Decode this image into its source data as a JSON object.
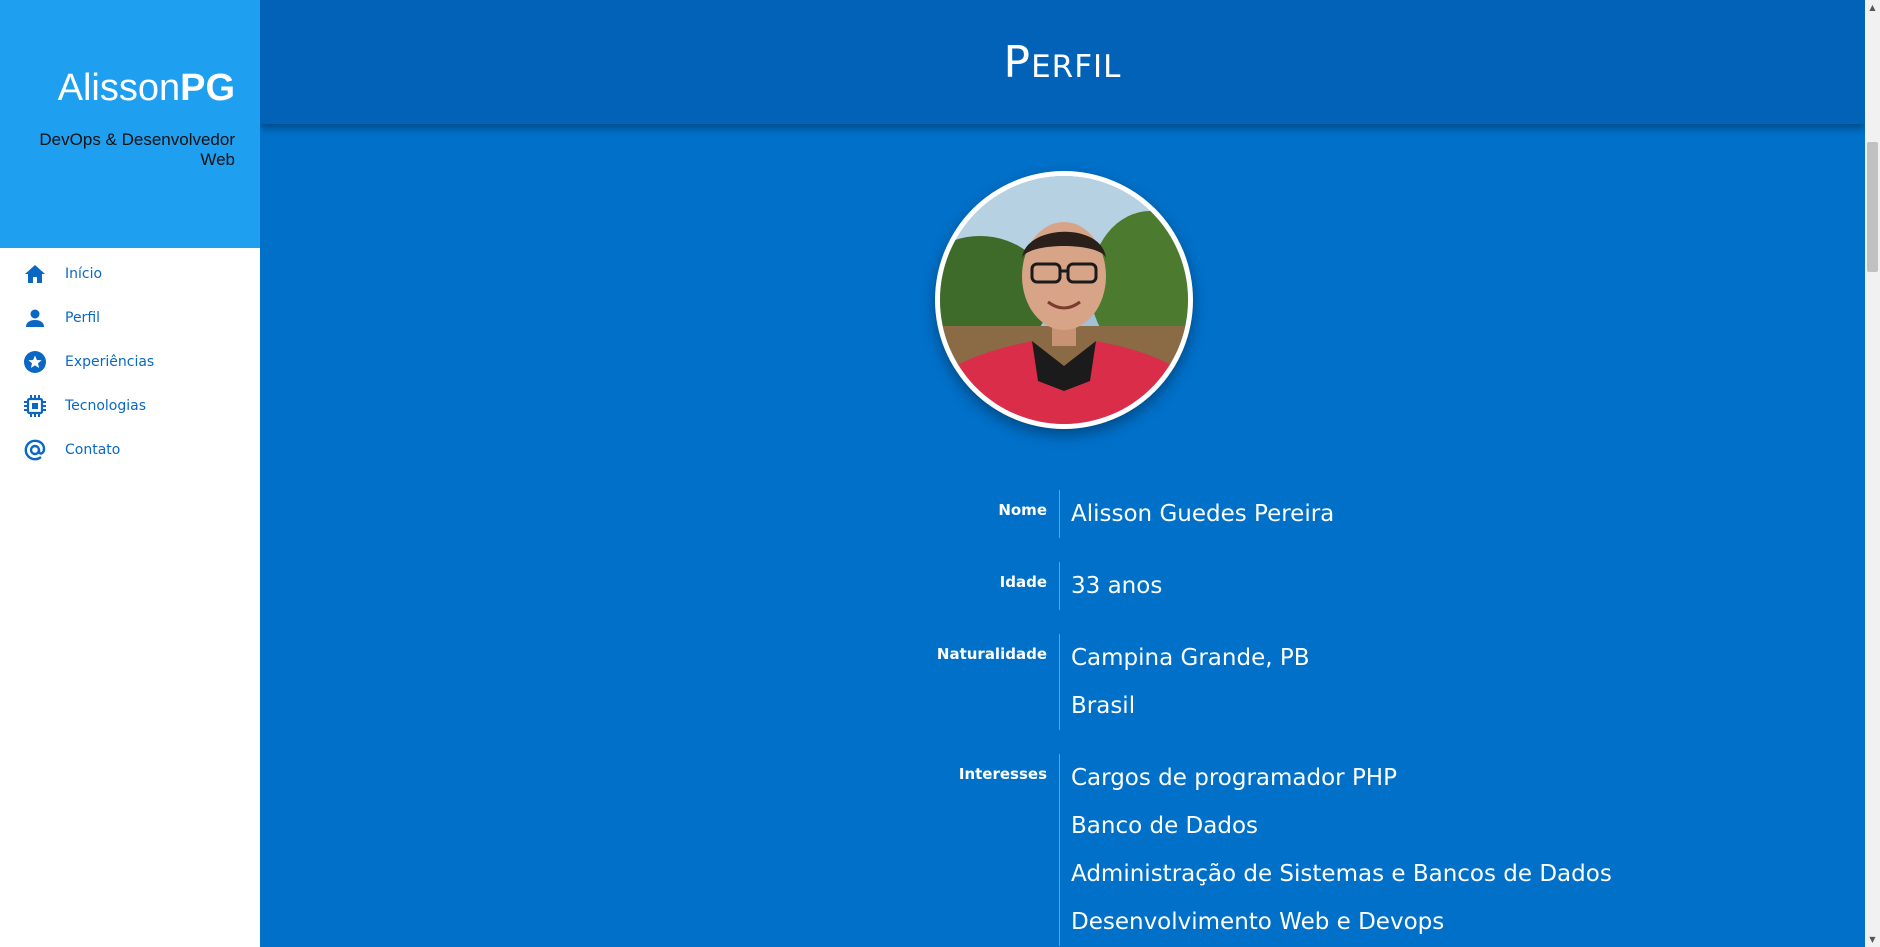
{
  "sidebar": {
    "brand": {
      "name_light": "Alisson",
      "name_bold": "PG",
      "subtitle": "DevOps & Desenvolvedor Web"
    },
    "items": [
      {
        "label": "Início",
        "icon": "home-icon"
      },
      {
        "label": "Perfil",
        "icon": "person-icon"
      },
      {
        "label": "Experiências",
        "icon": "star-icon"
      },
      {
        "label": "Tecnologias",
        "icon": "chip-icon"
      },
      {
        "label": "Contato",
        "icon": "at-icon"
      }
    ]
  },
  "header": {
    "title": "Perfil"
  },
  "profile": {
    "avatar": "profile-photo",
    "fields": [
      {
        "key": "Nome",
        "values": [
          "Alisson Guedes Pereira"
        ]
      },
      {
        "key": "Idade",
        "values": [
          "33 anos"
        ]
      },
      {
        "key": "Naturalidade",
        "values": [
          "Campina Grande, PB",
          "Brasil"
        ]
      },
      {
        "key": "Interesses",
        "values": [
          "Cargos de programador PHP",
          "Banco de Dados",
          "Administração de Sistemas e Bancos de Dados",
          "Desenvolvimento Web e Devops"
        ]
      }
    ]
  },
  "colors": {
    "sidebar_brand": "#1e9ff0",
    "header": "#0162b8",
    "main": "#0070c9",
    "nav_text": "#0a68c4"
  }
}
